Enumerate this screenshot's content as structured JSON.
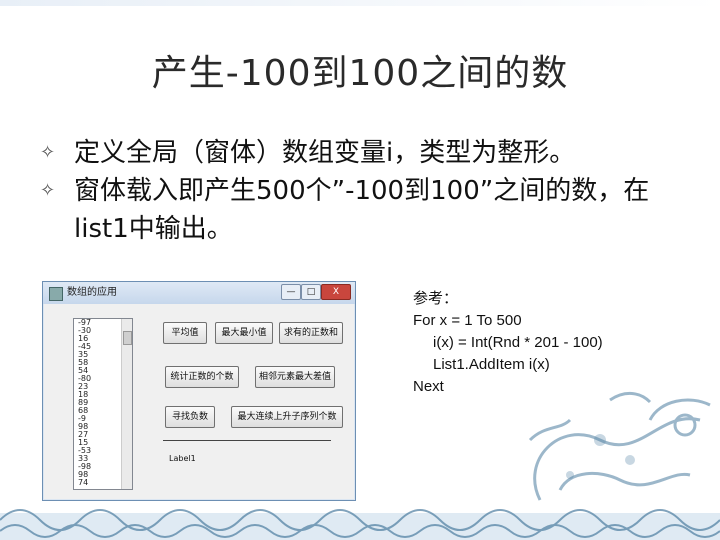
{
  "slide": {
    "title": "产生-100到100之间的数",
    "bullets": [
      "定义全局（窗体）数组变量i，类型为整形。",
      "窗体载入即产生500个”-100到100”之间的数，在list1中输出。"
    ],
    "bullet_glyph": "✧"
  },
  "window": {
    "title": "数组的应用",
    "controls": {
      "minimize": "—",
      "maximize": "□",
      "close": "X"
    },
    "list_items": [
      "-97",
      "-30",
      "16",
      "-45",
      "35",
      "58",
      "54",
      "-80",
      "23",
      "18",
      "89",
      "68",
      "-9",
      "98",
      "27",
      "15",
      "-53",
      "33",
      "-98",
      "98",
      "74"
    ],
    "buttons": [
      "平均值",
      "最大最小值",
      "求有的正数和",
      "统计正数的个数",
      "相邻元素最大差值",
      "寻找负数",
      "最大连续上升子序列个数"
    ],
    "label": "Label1"
  },
  "code": {
    "lines": [
      "参考：",
      "For x = 1 To 500",
      "i(x) = Int(Rnd * 201 - 100)",
      "List1.AddItem i(x)",
      "Next"
    ]
  },
  "colors": {
    "accent": "#6d8fb3",
    "close": "#c9463d",
    "ornament": "#4c7da0"
  }
}
